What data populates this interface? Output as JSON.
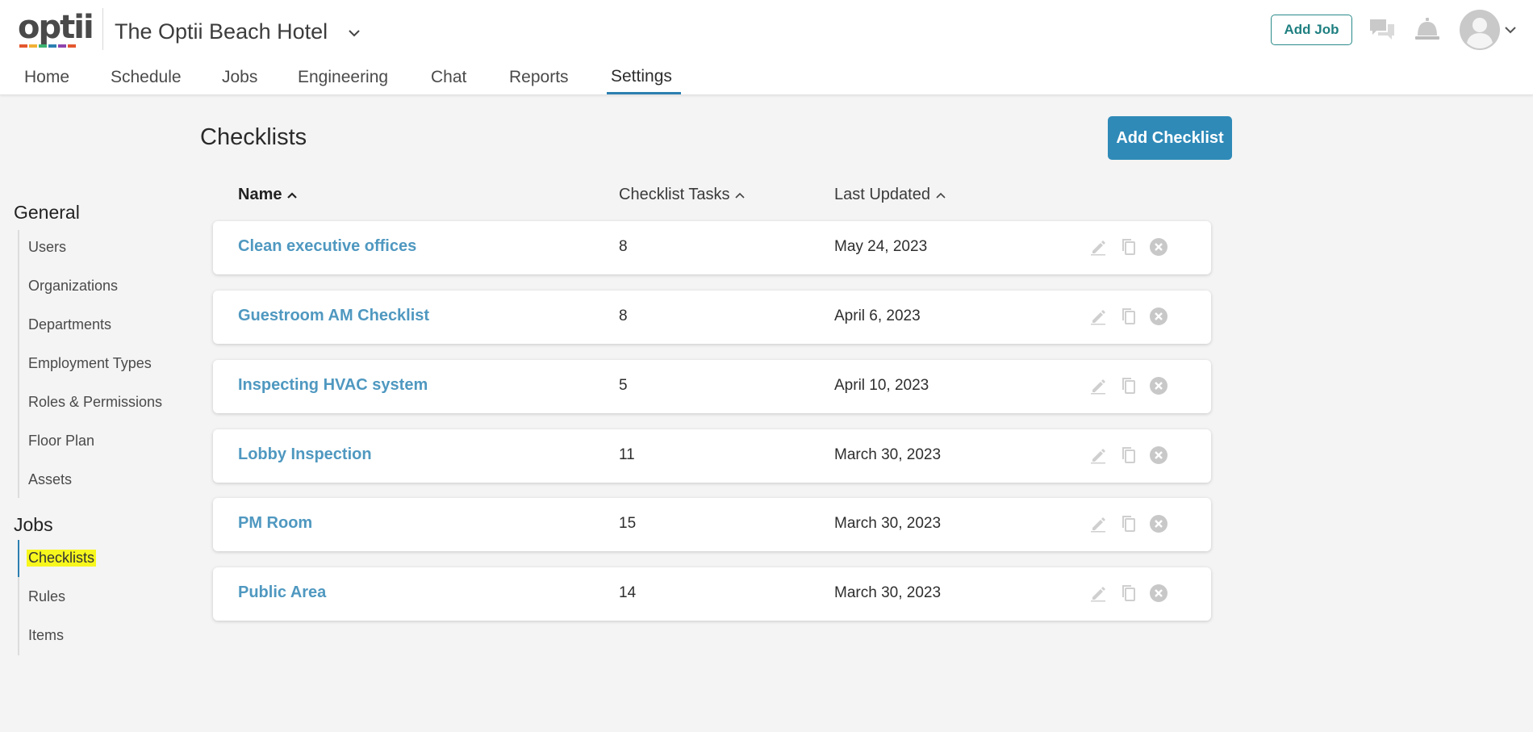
{
  "brand": {
    "logo_text": "optii",
    "logo_colors": [
      "#e4572e",
      "#f2b134",
      "#3cb371",
      "#2c7fb1",
      "#8e44ad",
      "#e4572e"
    ]
  },
  "header": {
    "hotel_name": "The Optii Beach Hotel",
    "add_job_label": "Add Job"
  },
  "nav": {
    "items": [
      {
        "label": "Home"
      },
      {
        "label": "Schedule"
      },
      {
        "label": "Jobs"
      },
      {
        "label": "Engineering"
      },
      {
        "label": "Chat"
      },
      {
        "label": "Reports"
      },
      {
        "label": "Settings"
      }
    ],
    "active": "Settings"
  },
  "sidebar": {
    "general_heading": "General",
    "general_items": [
      {
        "label": "Users"
      },
      {
        "label": "Organizations"
      },
      {
        "label": "Departments"
      },
      {
        "label": "Employment Types"
      },
      {
        "label": "Roles & Permissions"
      },
      {
        "label": "Floor Plan"
      },
      {
        "label": "Assets"
      }
    ],
    "jobs_heading": "Jobs",
    "jobs_items": [
      {
        "label": "Checklists"
      },
      {
        "label": "Rules"
      },
      {
        "label": "Items"
      }
    ],
    "active": "Checklists"
  },
  "main": {
    "title": "Checklists",
    "add_button_label": "Add Checklist",
    "columns": {
      "name": "Name",
      "tasks": "Checklist Tasks",
      "updated": "Last Updated"
    },
    "rows": [
      {
        "name": "Clean executive offices",
        "tasks": "8",
        "updated": "May 24, 2023"
      },
      {
        "name": "Guestroom AM Checklist",
        "tasks": "8",
        "updated": "April 6, 2023"
      },
      {
        "name": "Inspecting HVAC system",
        "tasks": "5",
        "updated": "April 10, 2023"
      },
      {
        "name": "Lobby Inspection",
        "tasks": "11",
        "updated": "March 30, 2023"
      },
      {
        "name": "PM Room",
        "tasks": "15",
        "updated": "March 30, 2023"
      },
      {
        "name": "Public Area",
        "tasks": "14",
        "updated": "March 30, 2023"
      }
    ],
    "row_actions": [
      "pencil-icon",
      "copy-icon",
      "close-circle-icon"
    ]
  },
  "colors": {
    "accent": "#2f8ab8",
    "link": "#4f98c0",
    "teal": "#1f7f80",
    "highlight": "#f7f71e"
  }
}
